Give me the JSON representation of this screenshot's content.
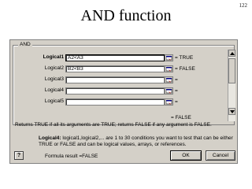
{
  "page_number": "122",
  "slide_title": "AND function",
  "dialog": {
    "group_label": "AND",
    "arguments": [
      {
        "label": "Logical1",
        "value": "A2<A3",
        "result": "= TRUE",
        "bold": true,
        "active": true
      },
      {
        "label": "Logical2",
        "value": "B2<B3",
        "result": "= FALSE",
        "bold": false,
        "active": false
      },
      {
        "label": "Logical3",
        "value": "",
        "result_prefix": "= ",
        "placeholder": "logical",
        "bold": false
      },
      {
        "label": "Logical4",
        "value": "",
        "result_prefix": "= ",
        "placeholder": "logical",
        "bold": false
      },
      {
        "label": "Logical5",
        "value": "",
        "result_prefix": "= ",
        "placeholder": "logical",
        "bold": false
      }
    ],
    "formula_result_preview": "= FALSE",
    "description": "Returns TRUE if all its arguments are TRUE; returns FALSE if any argument is FALSE.",
    "arg_help_name": "Logical4:",
    "arg_help_text": "logical1,logical2,... are 1 to 30 conditions you want to test that can be either TRUE or FALSE and can be logical values, arrays, or references.",
    "help_button": "?",
    "formula_result": "Formula result =FALSE",
    "ok_label": "OK",
    "cancel_label": "Cancel"
  }
}
